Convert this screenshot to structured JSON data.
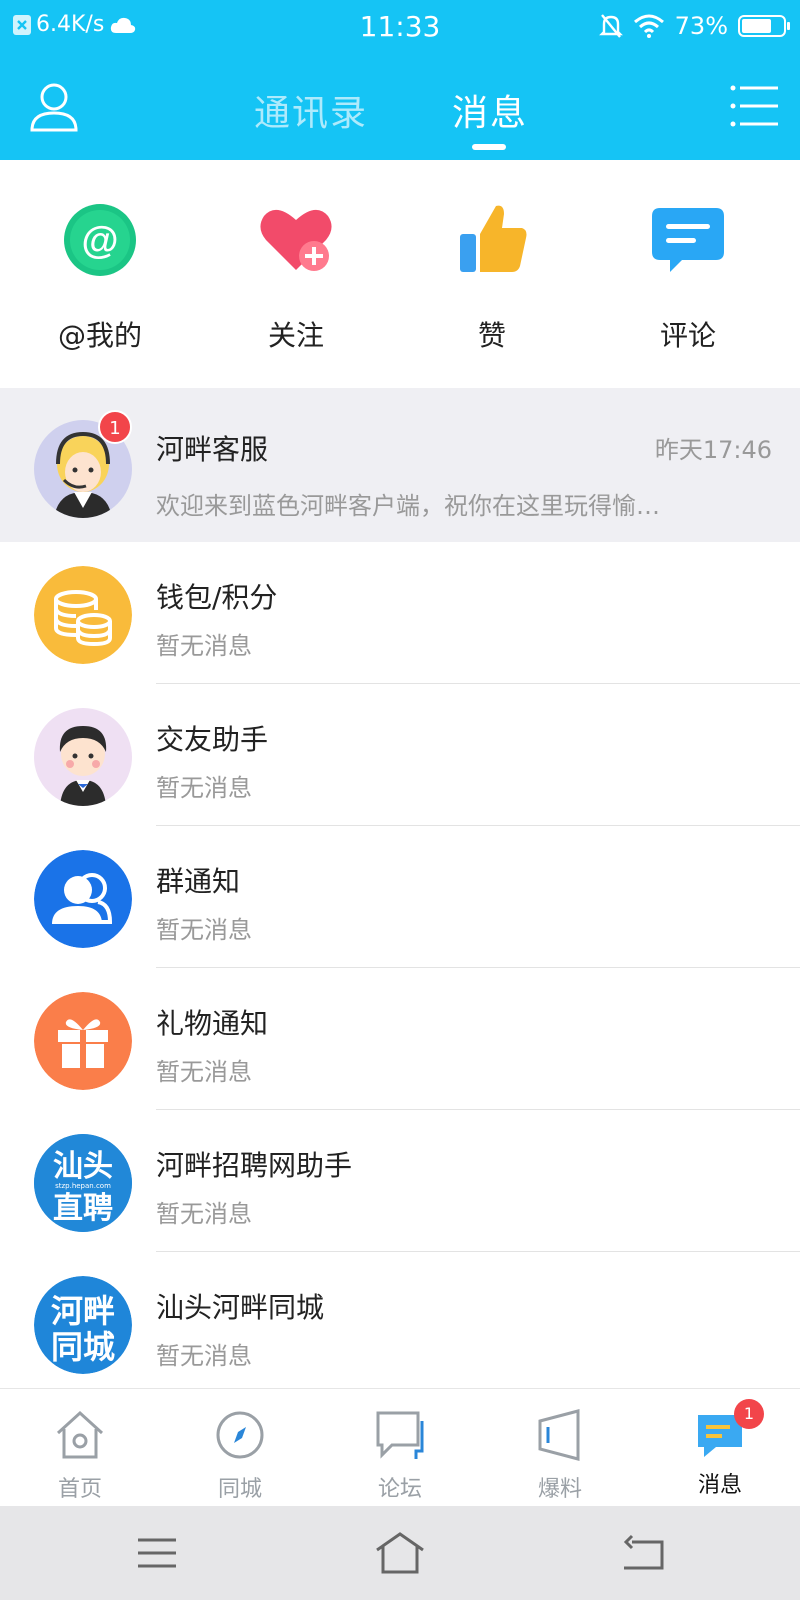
{
  "status_bar": {
    "net_speed": "6.4K/s",
    "time": "11:33",
    "battery": "73%",
    "battery_level": 0.73
  },
  "header": {
    "tabs": [
      {
        "label": "通讯录",
        "active": false
      },
      {
        "label": "消息",
        "active": true
      }
    ]
  },
  "quick_actions": [
    {
      "label": "@我的",
      "icon": "at-icon",
      "color": "#1bc585"
    },
    {
      "label": "关注",
      "icon": "heart-plus-icon",
      "color": "#f24b6a"
    },
    {
      "label": "赞",
      "icon": "thumbs-up-icon",
      "color": "#f7b52a"
    },
    {
      "label": "评论",
      "icon": "comment-icon",
      "color": "#29a7f5"
    }
  ],
  "messages": [
    {
      "title": "河畔客服",
      "preview": "欢迎来到蓝色河畔客户端，祝你在这里玩得愉…",
      "time": "昨天17:46",
      "badge": "1",
      "avatar": "customer-service-avatar"
    },
    {
      "title": "钱包/积分",
      "preview": "暂无消息",
      "avatar": "wallet-coins-icon",
      "color": "#f9bb3b"
    },
    {
      "title": "交友助手",
      "preview": "暂无消息",
      "avatar": "friend-assistant-avatar"
    },
    {
      "title": "群通知",
      "preview": "暂无消息",
      "avatar": "group-icon",
      "color": "#1a73e8"
    },
    {
      "title": "礼物通知",
      "preview": "暂无消息",
      "avatar": "gift-icon",
      "color": "#fa7e4a"
    },
    {
      "title": "河畔招聘网助手",
      "preview": "暂无消息",
      "avatar": "recruit-logo",
      "logo_text": [
        "汕头",
        "直聘"
      ],
      "logo_small": "stzp.hepan.com",
      "color": "#2188d8"
    },
    {
      "title": "汕头河畔同城",
      "preview": "暂无消息",
      "avatar": "city-logo",
      "logo_text": [
        "河畔",
        "同城"
      ],
      "color": "#1f86d9"
    }
  ],
  "bottom_nav": [
    {
      "label": "首页",
      "icon": "home-icon",
      "active": false
    },
    {
      "label": "同城",
      "icon": "compass-icon",
      "active": false
    },
    {
      "label": "论坛",
      "icon": "forum-icon",
      "active": false
    },
    {
      "label": "爆料",
      "icon": "speaker-icon",
      "active": false
    },
    {
      "label": "消息",
      "icon": "message-icon",
      "active": true,
      "badge": "1"
    }
  ],
  "theme": {
    "primary": "#15c4f5",
    "badge": "#f2454a"
  }
}
